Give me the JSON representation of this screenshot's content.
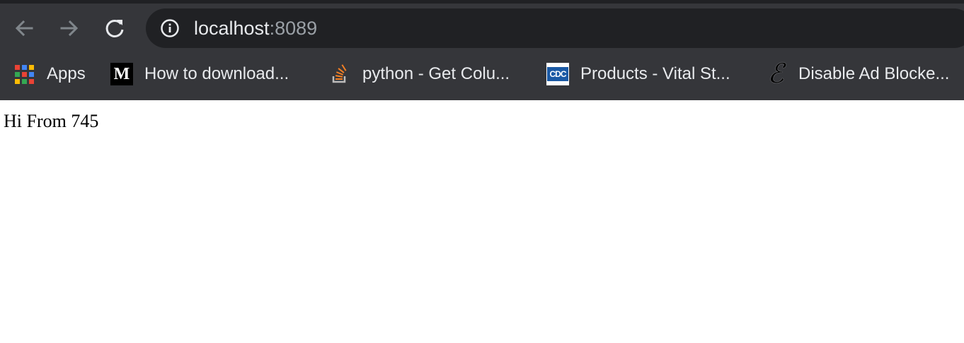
{
  "browser": {
    "url_host": "localhost",
    "url_port": ":8089",
    "icons": {
      "back": "arrow-left-icon",
      "forward": "arrow-right-icon",
      "reload": "reload-icon",
      "site_info": "info-circle-icon"
    }
  },
  "bookmarks": {
    "items": [
      {
        "label": "Apps",
        "icon": "apps-grid-icon"
      },
      {
        "label": "How to download...",
        "icon": "medium-logo-icon"
      },
      {
        "label": "python - Get Colu...",
        "icon": "stackoverflow-icon"
      },
      {
        "label": "Products - Vital St...",
        "icon": "cdc-logo-icon"
      },
      {
        "label": "Disable Ad Blocke...",
        "icon": "engadget-icon"
      }
    ]
  },
  "page": {
    "body_text": "Hi From 745"
  },
  "colors": {
    "toolbar_bg": "#35363a",
    "omnibox_bg": "#202124",
    "text_light": "#e8eaed",
    "text_muted": "#9aa0a6"
  }
}
